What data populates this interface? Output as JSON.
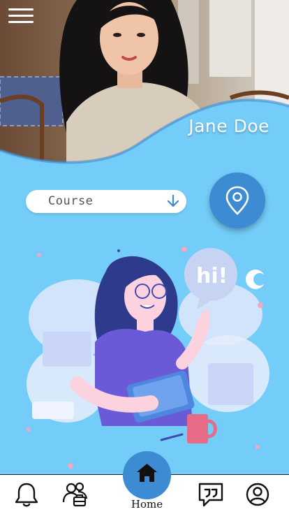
{
  "profile": {
    "name": "Jane Doe"
  },
  "course_select": {
    "label": "Course"
  },
  "bottom_nav": {
    "items": [
      {
        "icon": "bell-icon"
      },
      {
        "icon": "group-icon"
      },
      {
        "icon": "home-icon",
        "label": "Home",
        "active": true
      },
      {
        "icon": "chat-quote-icon"
      },
      {
        "icon": "user-icon"
      }
    ]
  },
  "colors": {
    "background": "#74cdf8",
    "accent": "#3d8bd3"
  }
}
